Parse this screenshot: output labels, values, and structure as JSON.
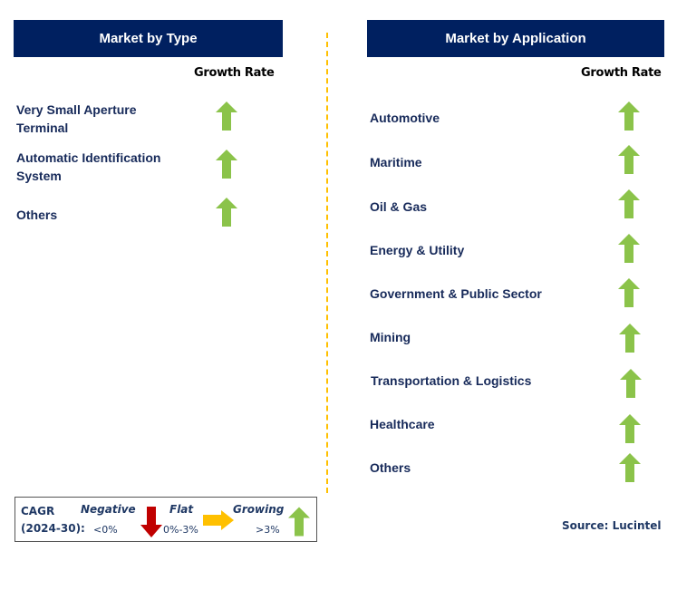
{
  "left_panel": {
    "title": "Market by Type",
    "growth_rate_label": "Growth Rate",
    "items": [
      {
        "label": "Very Small Aperture Terminal",
        "trend": "growing"
      },
      {
        "label": "Automatic Identification System",
        "trend": "growing"
      },
      {
        "label": "Others",
        "trend": "growing"
      }
    ]
  },
  "right_panel": {
    "title": "Market by Application",
    "growth_rate_label": "Growth Rate",
    "items": [
      {
        "label": "Automotive",
        "trend": "growing"
      },
      {
        "label": "Maritime",
        "trend": "growing"
      },
      {
        "label": "Oil & Gas",
        "trend": "growing"
      },
      {
        "label": "Energy & Utility",
        "trend": "growing"
      },
      {
        "label": "Government & Public Sector",
        "trend": "growing"
      },
      {
        "label": "Mining",
        "trend": "growing"
      },
      {
        "label": "Transportation & Logistics",
        "trend": "growing"
      },
      {
        "label": "Healthcare",
        "trend": "growing"
      },
      {
        "label": "Others",
        "trend": "growing"
      }
    ]
  },
  "legend": {
    "cagr_label": "CAGR",
    "period_label": "(2024-30):",
    "negative": {
      "label": "Negative",
      "range": "<0%",
      "icon": "arrow-down-icon",
      "color": "#c00000"
    },
    "flat": {
      "label": "Flat",
      "range": "0%-3%",
      "icon": "arrow-right-icon",
      "color": "#ffc000"
    },
    "growing": {
      "label": "Growing",
      "range": ">3%",
      "icon": "arrow-up-icon",
      "color": "#8bc34a"
    }
  },
  "source": "Source: Lucintel",
  "colors": {
    "header_bg": "#002060",
    "divider": "#ffc000",
    "up_arrow": "#8bc34a",
    "text": "#172a5a"
  }
}
